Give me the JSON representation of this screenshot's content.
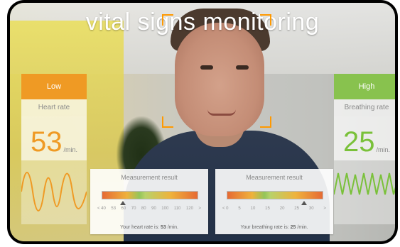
{
  "title": "vital signs monitoring",
  "left_panel": {
    "status": "Low",
    "label": "Heart rate",
    "value": "53",
    "unit": "/min."
  },
  "right_panel": {
    "status": "High",
    "label": "Breathing rate",
    "value": "25",
    "unit": "/min."
  },
  "results": [
    {
      "title": "Measurement result",
      "ticks": [
        "< 40",
        "53",
        "60",
        "70",
        "80",
        "90",
        "100",
        "110",
        "120",
        ">"
      ],
      "rate_prefix": "Your heart rate is:",
      "rate_value": "53",
      "rate_unit": "/min."
    },
    {
      "title": "Measurement result",
      "ticks": [
        "< 0",
        "5",
        "10",
        "15",
        "20",
        "25",
        "30",
        ">"
      ],
      "rate_prefix": "Your breathing rate is:",
      "rate_value": "25",
      "rate_unit": "/min."
    }
  ]
}
